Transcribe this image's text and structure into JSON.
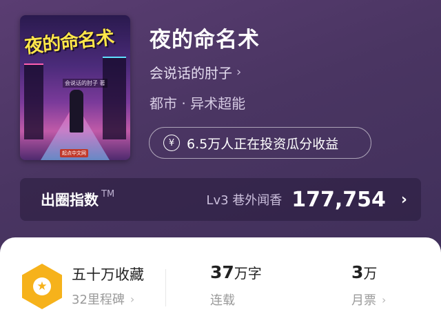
{
  "cover": {
    "title_art": "夜的命名术",
    "author_art": "会说话的肘子 著",
    "publisher_mark": "起点中文网"
  },
  "book": {
    "title": "夜的命名术",
    "author": "会说话的肘子",
    "genre": "都市 · 异术超能",
    "invest_text": "6.5万人正在投资瓜分收益"
  },
  "index": {
    "label": "出圈指数",
    "tm": "TM",
    "level": "Lv3 巷外闻香",
    "value": "177,754"
  },
  "stats": {
    "milestone_title": "五十万收藏",
    "milestone_sub": "32里程碑",
    "words_num": "37",
    "words_unit": "万字",
    "words_label": "连载",
    "tickets_num": "3",
    "tickets_unit": "万",
    "tickets_label": "月票"
  },
  "icons": {
    "yen": "yen-icon",
    "star_badge": "star-badge-icon",
    "chevron": "chevron-right-icon"
  },
  "colors": {
    "background": "#4a3562",
    "badge": "#f6b21b",
    "card": "#ffffff"
  }
}
